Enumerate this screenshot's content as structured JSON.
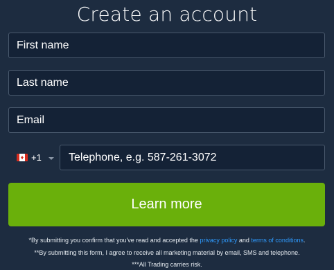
{
  "form": {
    "title": "Create an account",
    "first_name_placeholder": "First name",
    "last_name_placeholder": "Last name",
    "email_placeholder": "Email",
    "phone": {
      "country_flag": "canada-flag-icon",
      "dial_code": "+1",
      "placeholder": "Telephone, e.g. 587-261-3072"
    },
    "submit_label": "Learn more"
  },
  "disclaimer": {
    "line1_prefix": "*By submitting you confirm that you've read and accepted the ",
    "privacy_link": "privacy policy",
    "line1_mid": " and ",
    "terms_link": "terms of conditions",
    "line1_suffix": ".",
    "line2": "**By submitting this form, I agree to receive all marketing material by email, SMS and telephone.",
    "line3": "***All Trading carries risk."
  },
  "colors": {
    "background": "#1d2c40",
    "input_background": "#142236",
    "input_border": "#4a5a6e",
    "button_green": "#6ab00b",
    "link_blue": "#2e9bff"
  }
}
